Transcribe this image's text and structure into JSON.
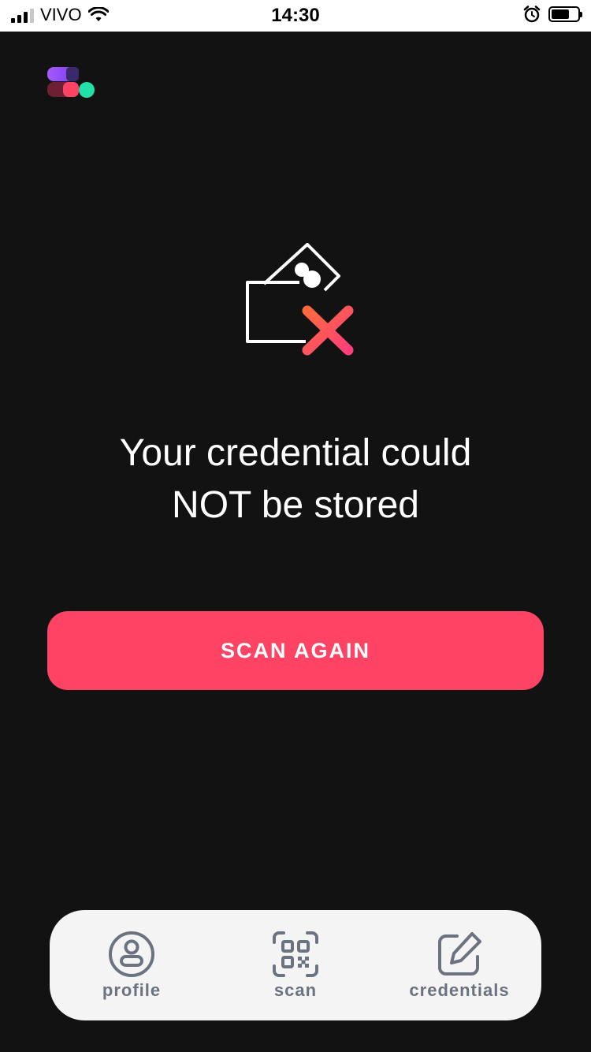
{
  "status_bar": {
    "carrier": "VIVO",
    "time": "14:30",
    "battery_level": 0.7
  },
  "icons": {
    "logo": "app-logo",
    "illustration": "wallet-error-icon",
    "nav_profile": "user-circle-icon",
    "nav_scan": "qr-code-icon",
    "nav_credentials": "edit-icon"
  },
  "colors": {
    "background": "#121212",
    "accent": "#ff4365",
    "nav_background": "#f4f4f4",
    "nav_icon": "#6b7280"
  },
  "main": {
    "message_line1": "Your credential could",
    "message_line2": "NOT be stored",
    "button_label": "SCAN AGAIN"
  },
  "nav": {
    "items": [
      {
        "label": "profile"
      },
      {
        "label": "scan"
      },
      {
        "label": "credentials"
      }
    ]
  }
}
